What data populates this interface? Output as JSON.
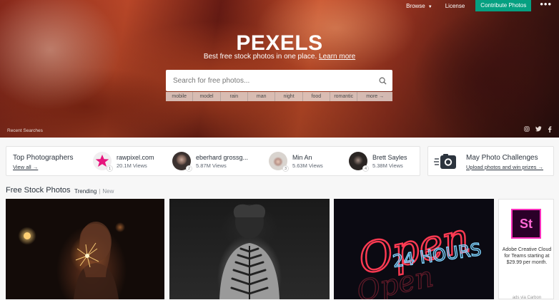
{
  "nav": {
    "browse_label": "Browse",
    "license_label": "License",
    "contribute_label": "Contribute Photos",
    "more_label": "•••"
  },
  "hero": {
    "brand": "PEXELS",
    "tagline": "Best free stock photos in one place.",
    "learn_more": "Learn more",
    "recent_searches": "Recent Searches"
  },
  "search": {
    "placeholder": "Search for free photos...",
    "value": ""
  },
  "tags": [
    "mobile",
    "model",
    "rain",
    "man",
    "night",
    "food",
    "romantic",
    "more →"
  ],
  "top_photographers": {
    "title": "Top Photographers",
    "view_all": "View all →",
    "items": [
      {
        "rank": "1",
        "name": "rawpixel.com",
        "views": "20.1M Views"
      },
      {
        "rank": "2",
        "name": "eberhard grossg...",
        "views": "5.87M Views"
      },
      {
        "rank": "3",
        "name": "Min An",
        "views": "5.63M Views"
      },
      {
        "rank": "4",
        "name": "Brett Sayles",
        "views": "5.38M Views"
      }
    ]
  },
  "challenge": {
    "title": "May Photo Challenges",
    "subtitle": "Upload photos and win prizes →"
  },
  "section": {
    "title": "Free Stock Photos",
    "tab_trending": "Trending",
    "separator": "|",
    "tab_new": "New"
  },
  "photos": [
    {
      "icon": "sparkler-photo"
    },
    {
      "icon": "fern-back-photo"
    },
    {
      "icon": "neon-sign-photo",
      "neon_text_1": "Open",
      "neon_text_2": "24 HOURS"
    }
  ],
  "ad": {
    "logo_text": "St",
    "text": "Adobe Creative Cloud for Teams starting at $29.99 per month.",
    "by": "ads via Carbon"
  },
  "colors": {
    "accent_green": "#05a081",
    "neon_red": "#ff3a52",
    "neon_blue": "#7fd4ff"
  }
}
